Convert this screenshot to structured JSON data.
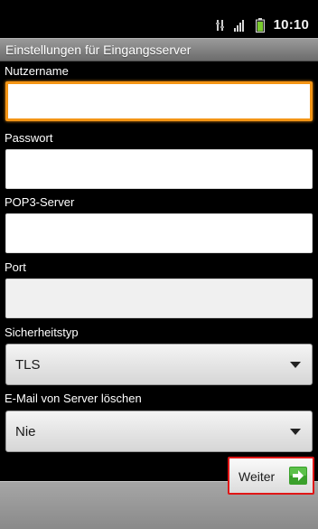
{
  "status_bar": {
    "time": "10:10",
    "icons": [
      "data-sync-icon",
      "signal-strength-icon",
      "battery-icon"
    ]
  },
  "title_bar": {
    "title": "Einstellungen für Eingangsserver"
  },
  "form": {
    "username": {
      "label": "Nutzername",
      "value": "",
      "focused": true
    },
    "password": {
      "label": "Passwort",
      "value": ""
    },
    "pop3_server": {
      "label": "POP3-Server",
      "value": ""
    },
    "port": {
      "label": "Port",
      "value": ""
    },
    "security_type": {
      "label": "Sicherheitstyp",
      "selected": "TLS"
    },
    "delete_from_server": {
      "label": "E-Mail von Server löschen",
      "selected": "Nie"
    }
  },
  "actions": {
    "next_label": "Weiter"
  },
  "colors": {
    "focus_ring": "#f49515",
    "highlight_border": "#e01616",
    "next_icon_green": "#3aa02b"
  }
}
